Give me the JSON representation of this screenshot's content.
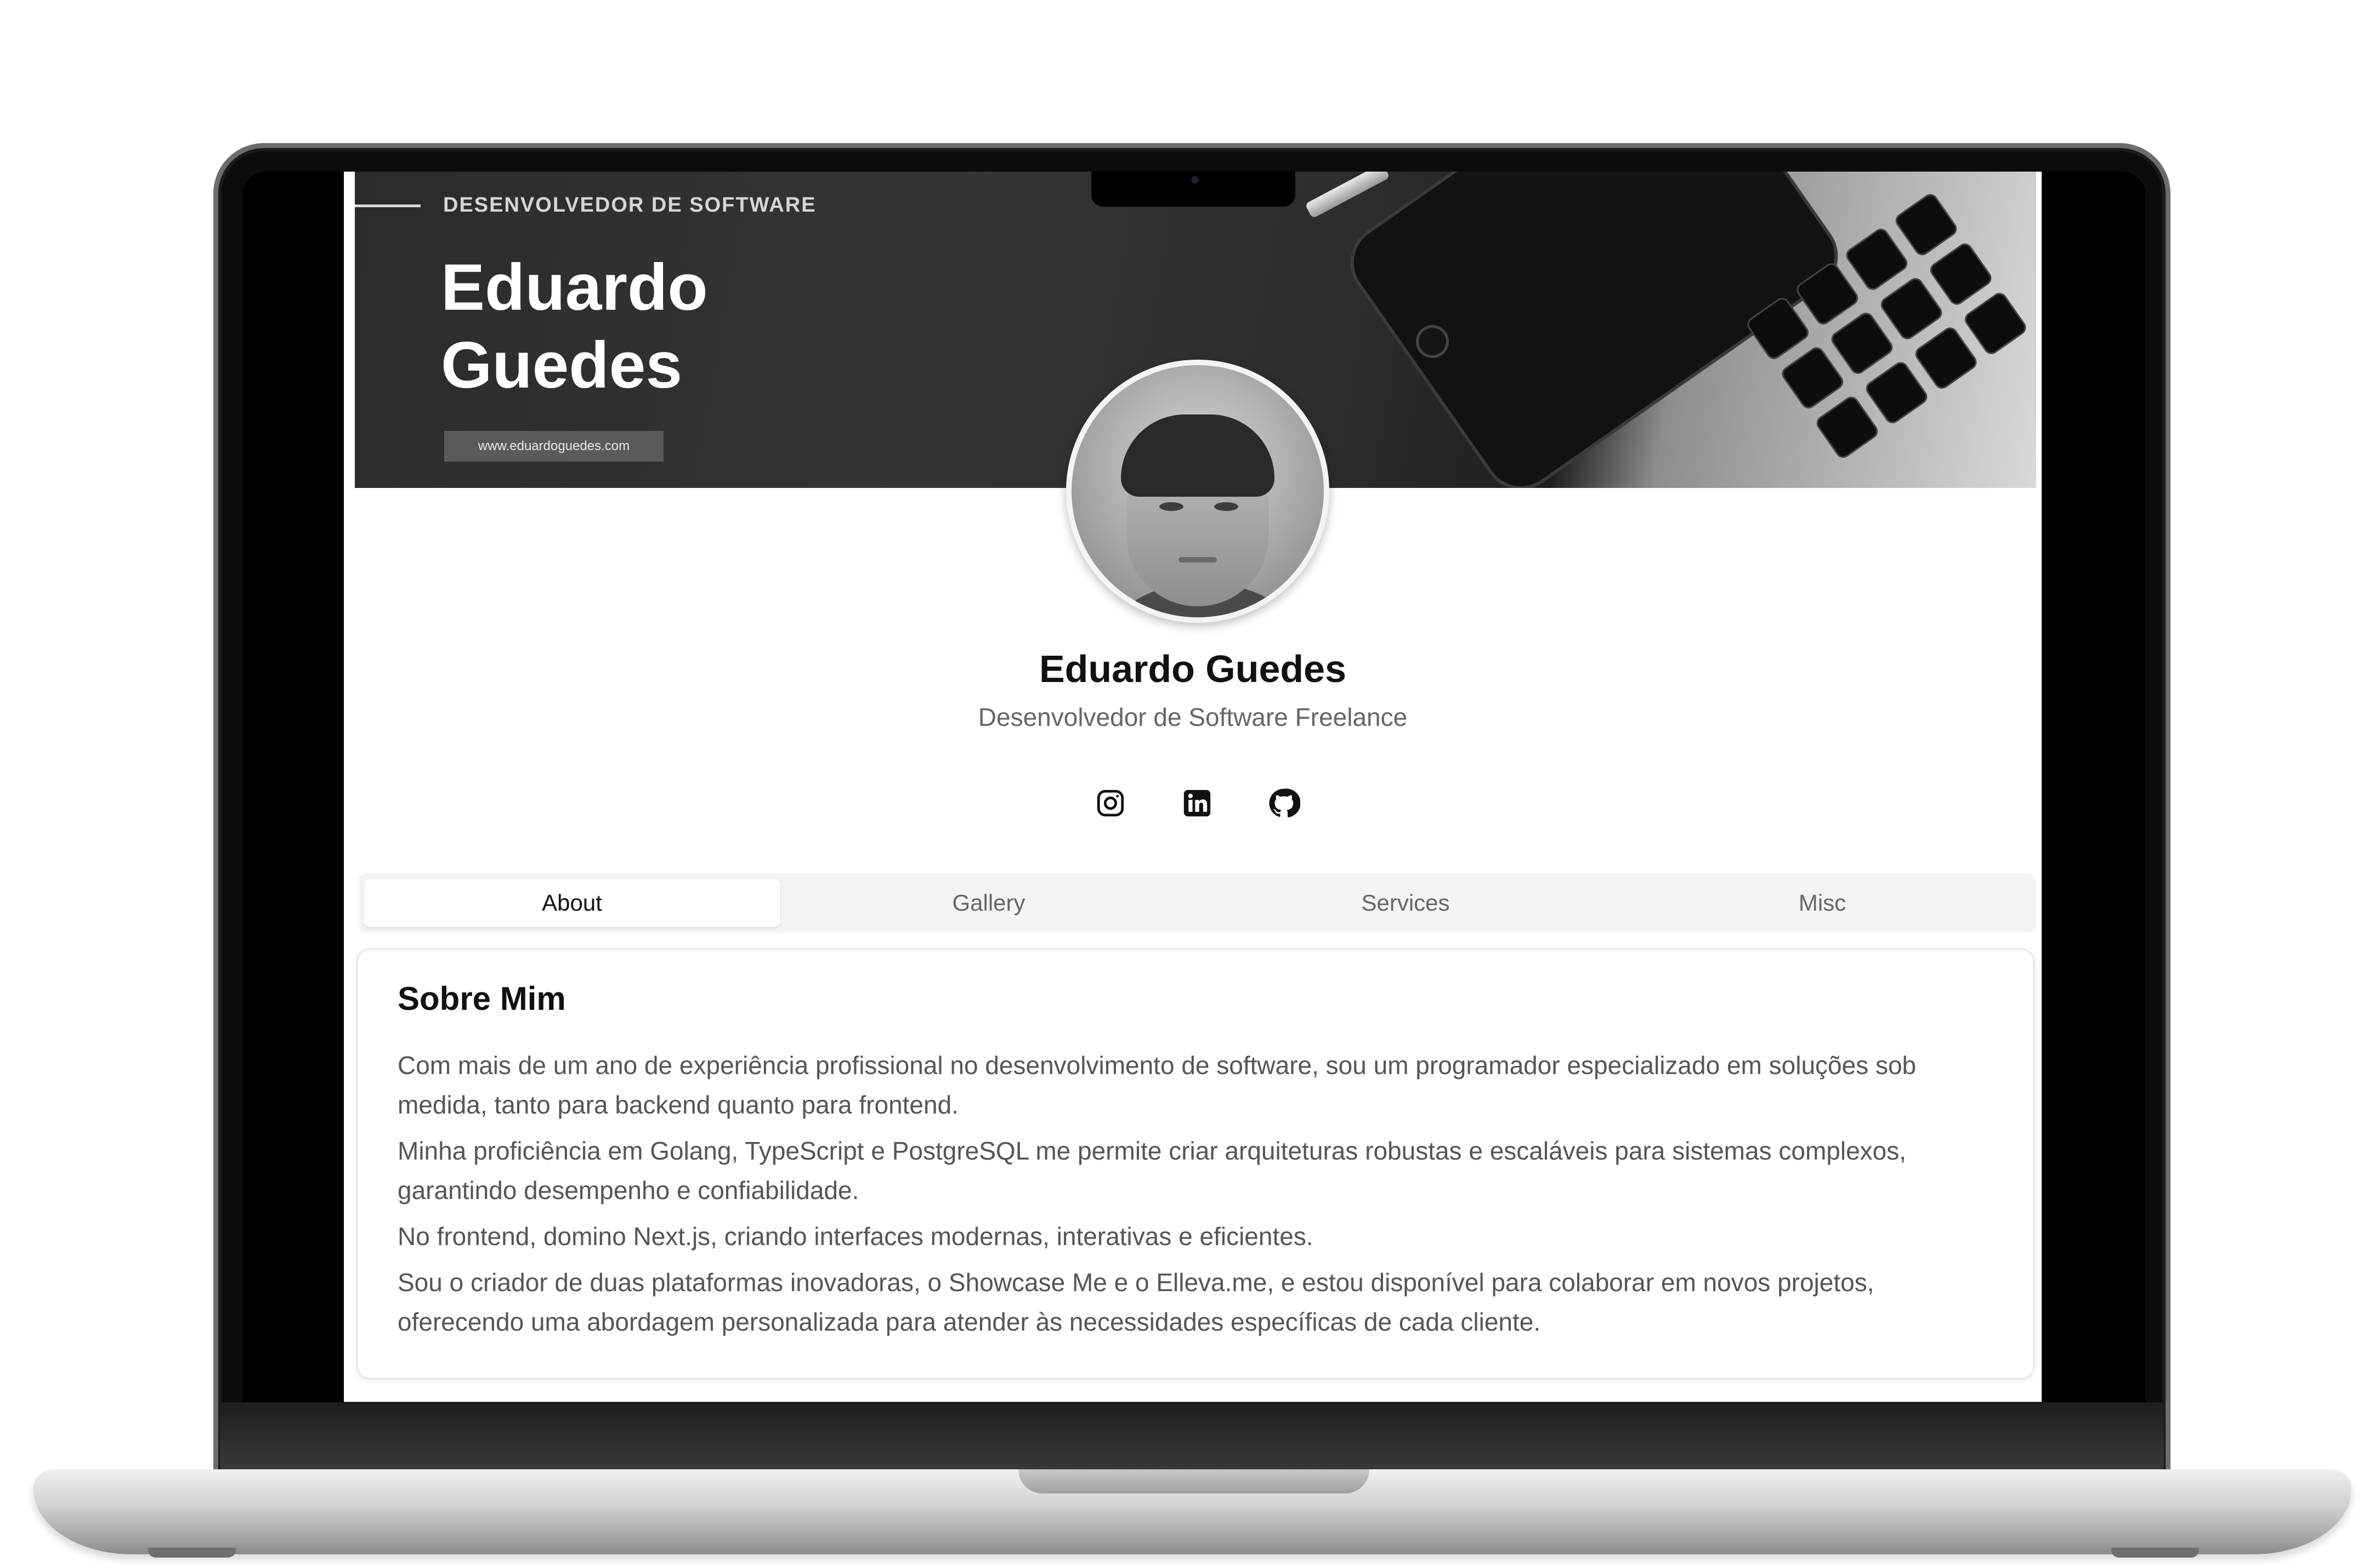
{
  "banner": {
    "kicker": "DESENVOLVEDOR DE SOFTWARE",
    "title": "Eduardo Guedes",
    "url": "www.eduardoguedes.com"
  },
  "profile": {
    "name": "Eduardo Guedes",
    "role": "Desenvolvedor de Software Freelance"
  },
  "socials": [
    {
      "icon": "instagram-icon"
    },
    {
      "icon": "linkedin-icon"
    },
    {
      "icon": "github-icon"
    }
  ],
  "tabs": [
    {
      "label": "About",
      "active": true
    },
    {
      "label": "Gallery",
      "active": false
    },
    {
      "label": "Services",
      "active": false
    },
    {
      "label": "Misc",
      "active": false
    }
  ],
  "about": {
    "title": "Sobre Mim",
    "paragraphs": [
      "Com mais de um ano de experiência profissional no desenvolvimento de software, sou um programador especializado em soluções sob medida, tanto para backend quanto para frontend.",
      "Minha proficiência em Golang, TypeScript e PostgreSQL me permite criar arquiteturas robustas e escaláveis para sistemas complexos, garantindo desempenho e confiabilidade.",
      "No frontend, domino Next.js, criando interfaces modernas, interativas e eficientes.",
      "Sou o criador de duas plataformas inovadoras, o Showcase Me e o Elleva.me, e estou disponível para colaborar em novos projetos, oferecendo uma abordagem personalizada para atender às necessidades específicas de cada cliente."
    ]
  }
}
